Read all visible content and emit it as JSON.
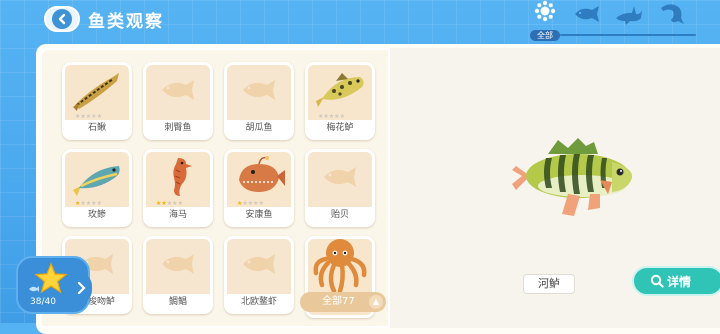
{
  "header": {
    "title": "鱼类观察",
    "filter_all_label": "全部"
  },
  "fish_cards": [
    {
      "name": "石鳅",
      "unlocked": true,
      "stars": 0
    },
    {
      "name": "刺臀鱼",
      "unlocked": false,
      "stars": 0
    },
    {
      "name": "胡瓜鱼",
      "unlocked": false,
      "stars": 0
    },
    {
      "name": "梅花鲈",
      "unlocked": true,
      "stars": 0
    },
    {
      "name": "玫鲹",
      "unlocked": true,
      "stars": 1
    },
    {
      "name": "海马",
      "unlocked": true,
      "stars": 2
    },
    {
      "name": "安康鱼",
      "unlocked": true,
      "stars": 1
    },
    {
      "name": "贻贝",
      "unlocked": false,
      "stars": 0
    },
    {
      "name": "白梭吻鲈",
      "unlocked": false,
      "stars": 0
    },
    {
      "name": "鲷鲳",
      "unlocked": false,
      "stars": 0
    },
    {
      "name": "北欧鳌虾",
      "unlocked": false,
      "stars": 0
    },
    {
      "name": "章鱼",
      "unlocked": true,
      "stars": 0
    }
  ],
  "total_filter": "全部77",
  "star_progress": "38/40",
  "selected_fish": {
    "name": "河鲈"
  },
  "detail_button": "详情",
  "colors": {
    "accent_blue": "#4aa8ee",
    "detail_teal": "#2fc4b6",
    "star_yellow": "#f4b400",
    "card_bg": "#f7e6cc"
  }
}
